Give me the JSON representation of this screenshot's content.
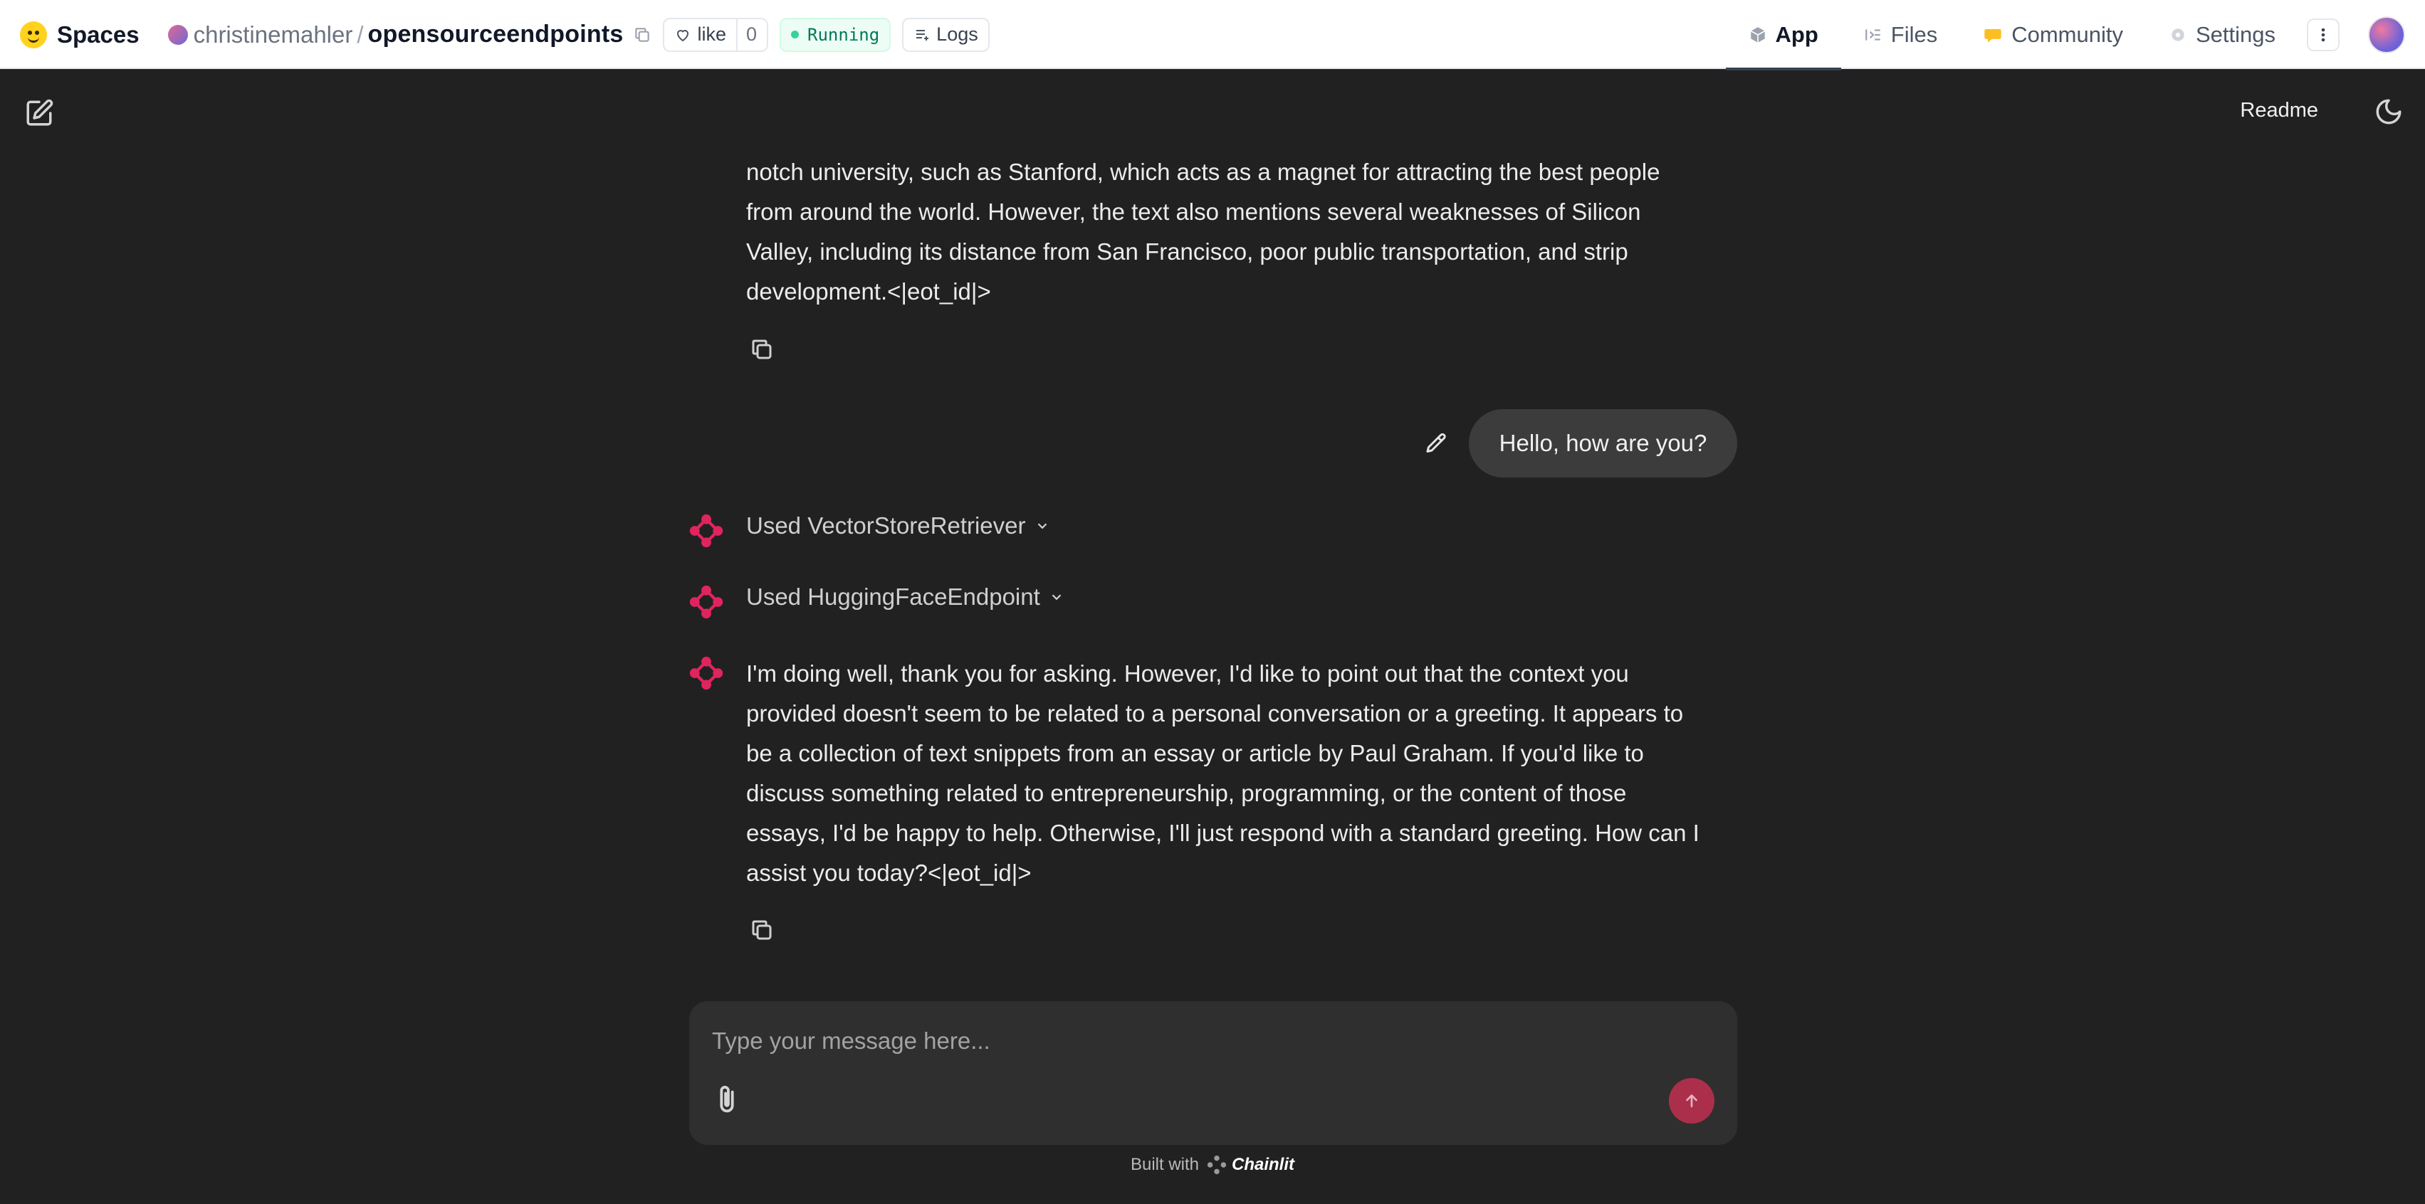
{
  "topbar": {
    "spaces_label": "Spaces",
    "owner": "christinemahler",
    "separator": "/",
    "repo": "opensourceendpoints",
    "like_label": "like",
    "like_count": "0",
    "status": "Running",
    "logs_label": "Logs",
    "nav": [
      {
        "label": "App",
        "icon": "cube-icon",
        "active": true
      },
      {
        "label": "Files",
        "icon": "files-icon",
        "active": false
      },
      {
        "label": "Community",
        "icon": "community-icon",
        "active": false
      },
      {
        "label": "Settings",
        "icon": "gear-icon",
        "active": false
      }
    ]
  },
  "app_header": {
    "readme_label": "Readme"
  },
  "messages": {
    "assistant_first": [
      "notch university, such as Stanford, which acts as a magnet for attracting the best people",
      "from around the world. However, the text also mentions several weaknesses of Silicon",
      "Valley, including its distance from San Francisco, poor public transportation, and strip",
      "development.<|eot_id|>"
    ],
    "user_message": "Hello, how are you?",
    "steps": [
      {
        "label": "Used VectorStoreRetriever"
      },
      {
        "label": "Used HuggingFaceEndpoint"
      }
    ],
    "assistant_reply": [
      "I'm doing well, thank you for asking. However, I'd like to point out that the context you",
      "provided doesn't seem to be related to a personal conversation or a greeting. It appears to",
      "be a collection of text snippets from an essay or article by Paul Graham. If you'd like to",
      "discuss something related to entrepreneurship, programming, or the content of those",
      "essays, I'd be happy to help. Otherwise, I'll just respond with a standard greeting. How can I",
      "assist you today?<|eot_id|>"
    ]
  },
  "composer": {
    "placeholder": "Type your message here..."
  },
  "footer": {
    "built_with": "Built with",
    "brand": "Chainlit"
  },
  "colors": {
    "background": "#212121",
    "accent": "#e0245e",
    "send_button": "#b9304f",
    "running": "#047857"
  }
}
